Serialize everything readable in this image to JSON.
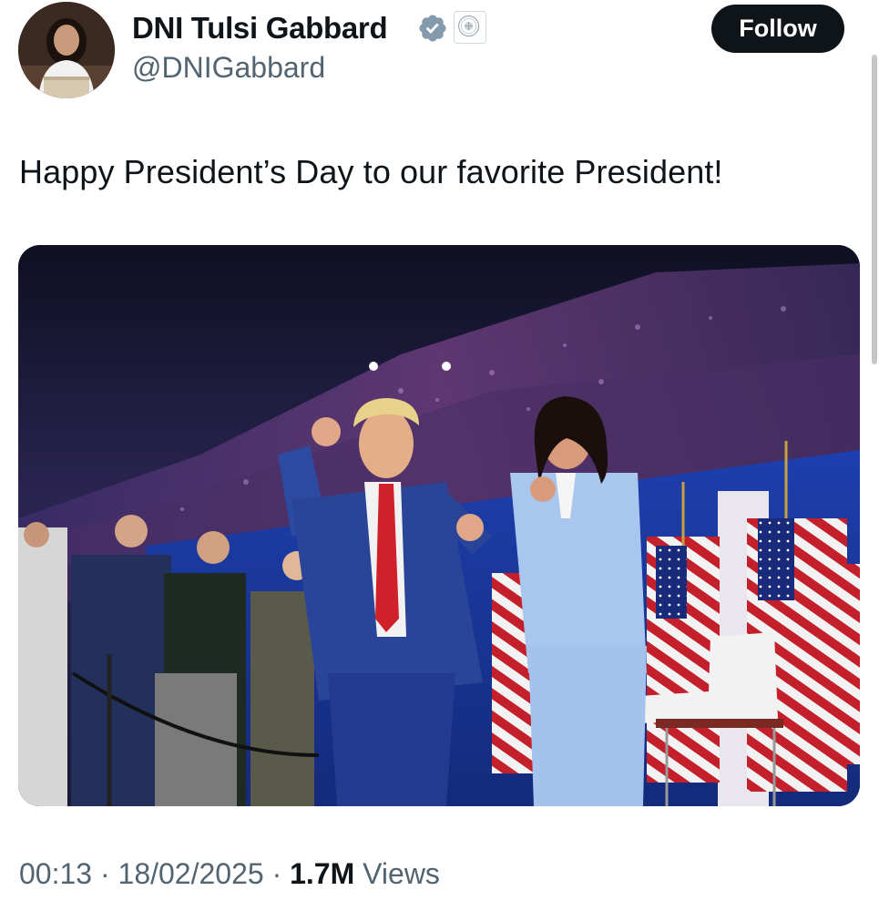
{
  "tweet": {
    "author": {
      "display_name": "DNI Tulsi Gabbard",
      "handle": "@DNIGabbard",
      "verified": true,
      "verified_color": "#829aab"
    },
    "follow_label": "Follow",
    "text": "Happy President’s Day to our favorite President!",
    "media": {
      "type": "photo",
      "icon": "photo-image"
    },
    "meta": {
      "time": "00:13",
      "separator": "·",
      "date": "18/02/2025",
      "views_count": "1.7M",
      "views_label": "Views"
    }
  },
  "colors": {
    "text_primary": "#0f1419",
    "text_secondary": "#536471",
    "follow_bg": "#0f1419",
    "follow_text": "#ffffff"
  }
}
